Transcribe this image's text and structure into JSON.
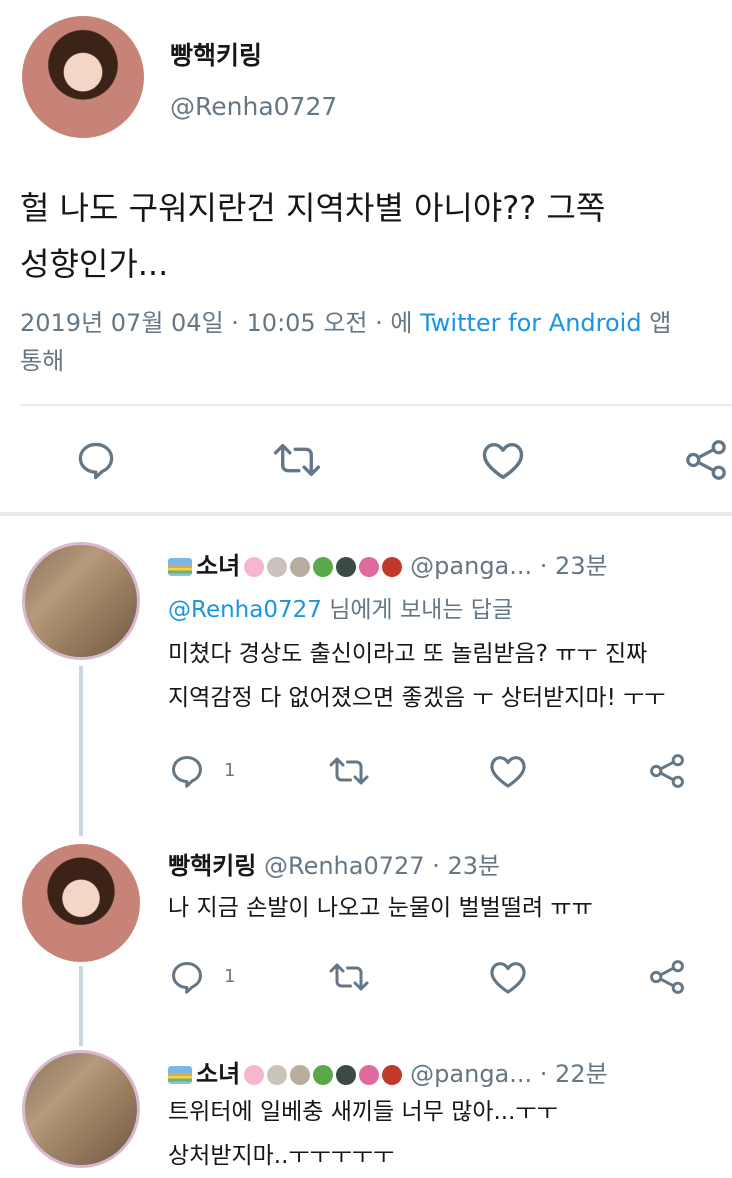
{
  "main_tweet": {
    "display_name": "빵핵키링",
    "handle": "@Renha0727",
    "text_line1": "헐 나도 구워지란건 지역차별 아니야?? 그쪽",
    "text_line2": "성향인가...",
    "meta_line1_prefix": "2019년 07월 04일 · 10:05 오전 · 에 ",
    "meta_source": "Twitter for Android",
    "meta_line1_suffix": " 앱",
    "meta_line2": "통해"
  },
  "replies": [
    {
      "display_name": "소녀",
      "handle": "@panga...",
      "time": "· 23분",
      "replying_to_handle": "@Renha0727",
      "replying_to_suffix": " 님에게 보내는 답글",
      "text_line1": "미쳤다 경상도 출신이라고 또 놀림받음? ㅠㅜ 진짜",
      "text_line2": "지역감정 다 없어졌으면 좋겠음 ㅜ 상터받지마! ㅜㅜ",
      "reply_count": "1"
    },
    {
      "display_name": "빵핵키링",
      "handle": "@Renha0727",
      "time": "· 23분",
      "text_line1": "나 지금 손발이 나오고 눈물이 벌벌떨려 ㅠㅠ",
      "reply_count": "1"
    },
    {
      "display_name": "소녀",
      "handle": "@panga...",
      "time": "· 22분",
      "text_line1": "트위터에 일베충 새끼들 너무 많아...ㅜㅜ",
      "text_line2": "상처받지마..ㅜㅜㅜㅜㅜ"
    }
  ],
  "colors": {
    "accent": "#1b95e0",
    "text": "#14171a",
    "secondary": "#657786",
    "divider": "#e6ecf0"
  },
  "icons": [
    "reply-icon",
    "retweet-icon",
    "like-icon",
    "share-icon"
  ]
}
